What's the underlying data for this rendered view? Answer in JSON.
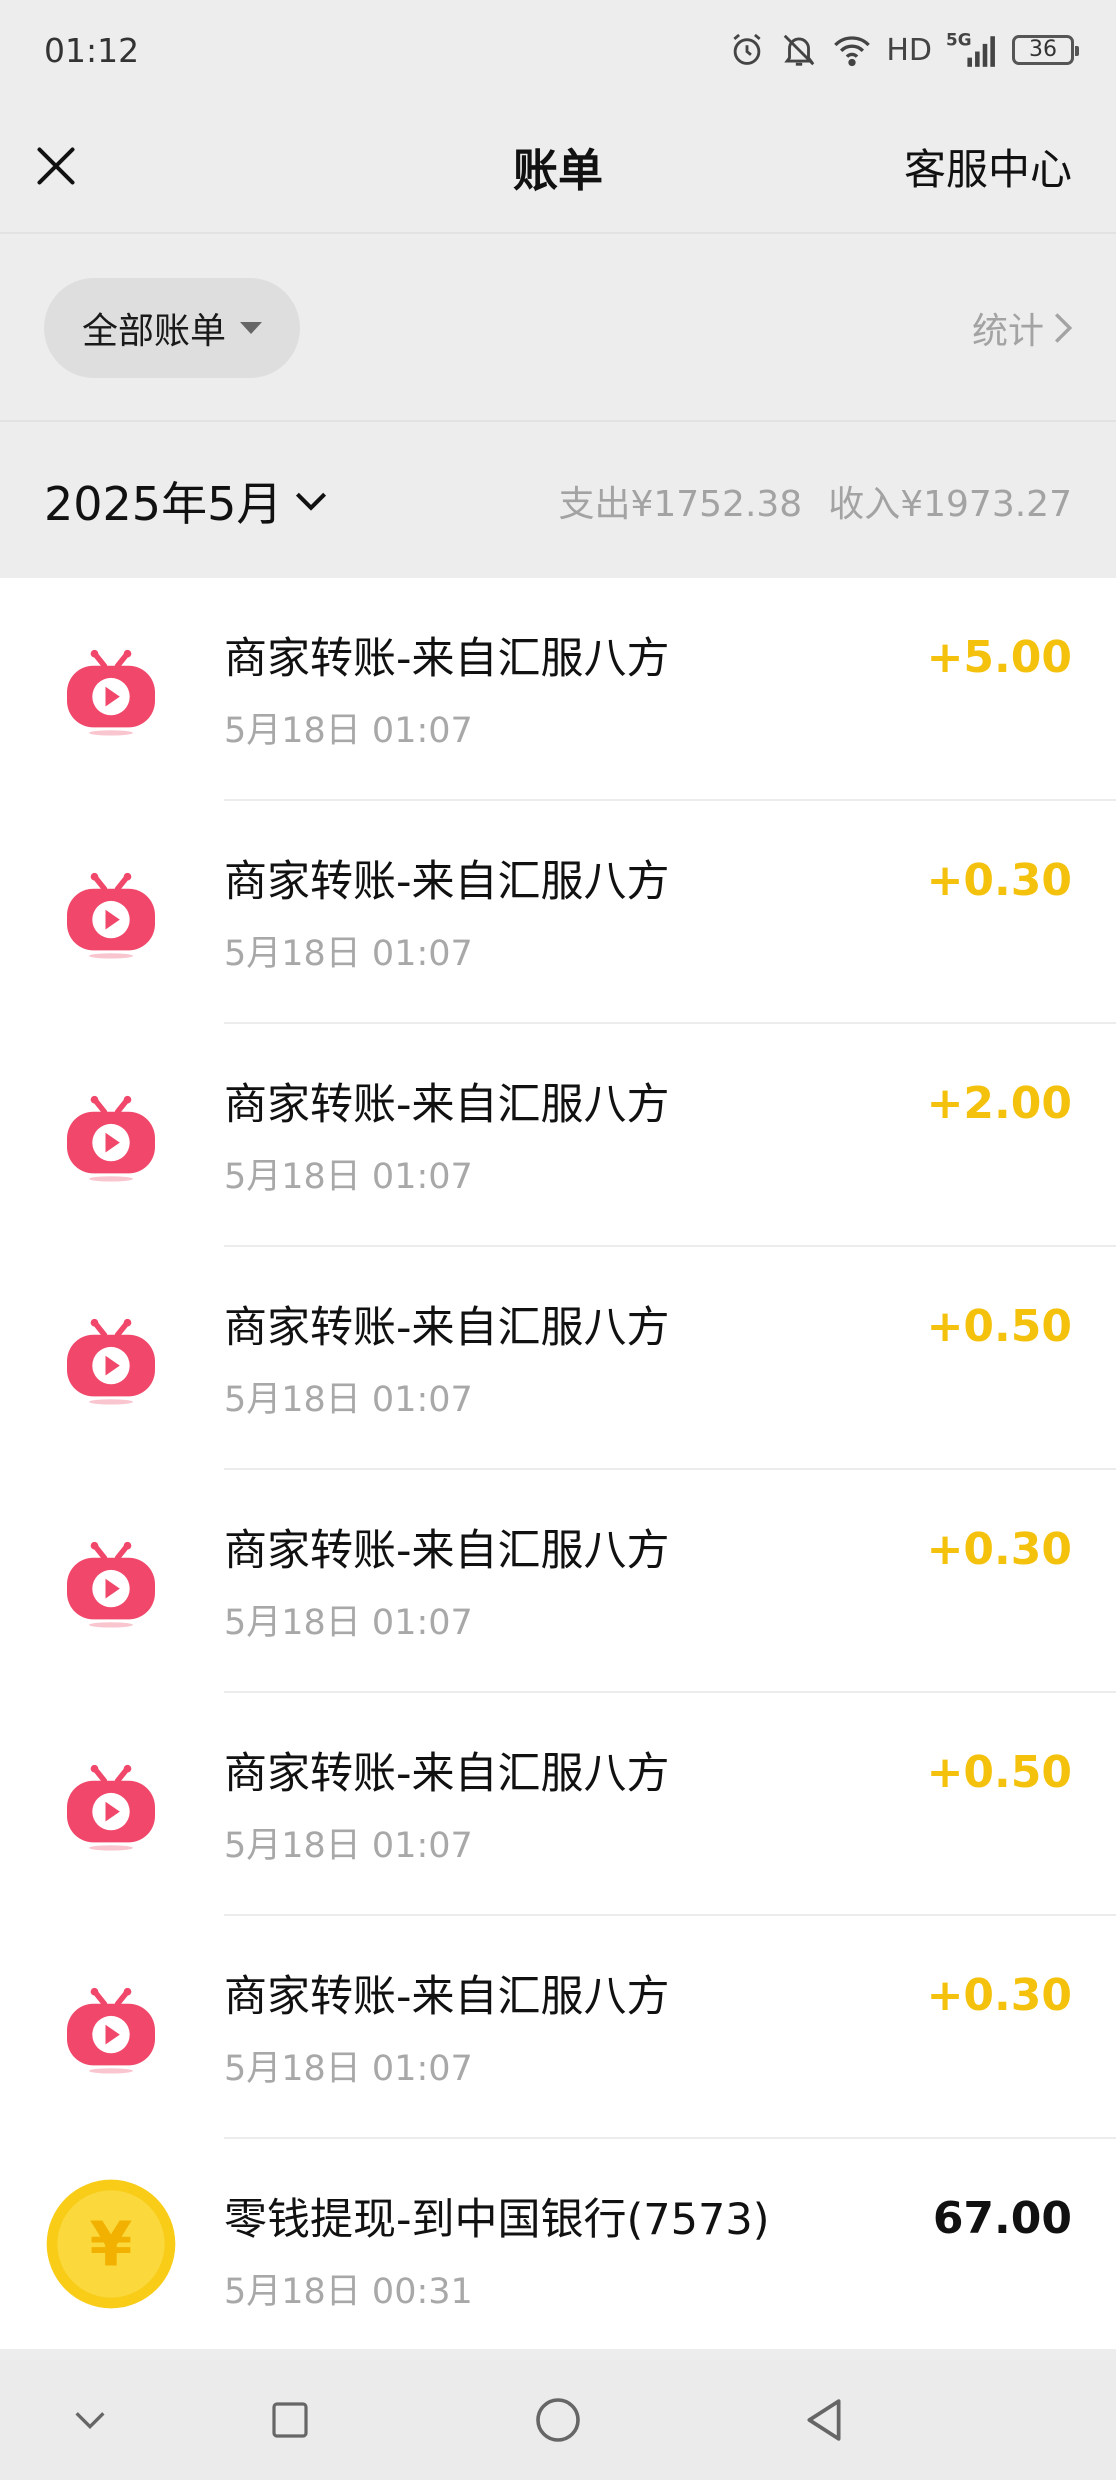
{
  "status_bar": {
    "time": "01:12",
    "network": "HD",
    "signal_label": "5G",
    "battery": "36"
  },
  "nav": {
    "title": "账单",
    "service": "客服中心"
  },
  "filter": {
    "label": "全部账单",
    "stats": "统计"
  },
  "month": {
    "label": "2025年5月",
    "expense": "支出¥1752.38",
    "income": "收入¥1973.27"
  },
  "colors": {
    "income_amount": "#f4c20d",
    "neutral_amount": "#111111",
    "merchant_icon": "#f0476a",
    "coin_icon": "#f8cc17"
  },
  "transactions": [
    {
      "title": "商家转账-来自汇服八方",
      "time": "5月18日 01:07",
      "amount": "+5.00",
      "icon": "tv-play-icon"
    },
    {
      "title": "商家转账-来自汇服八方",
      "time": "5月18日 01:07",
      "amount": "+0.30",
      "icon": "tv-play-icon"
    },
    {
      "title": "商家转账-来自汇服八方",
      "time": "5月18日 01:07",
      "amount": "+2.00",
      "icon": "tv-play-icon"
    },
    {
      "title": "商家转账-来自汇服八方",
      "time": "5月18日 01:07",
      "amount": "+0.50",
      "icon": "tv-play-icon"
    },
    {
      "title": "商家转账-来自汇服八方",
      "time": "5月18日 01:07",
      "amount": "+0.30",
      "icon": "tv-play-icon"
    },
    {
      "title": "商家转账-来自汇服八方",
      "time": "5月18日 01:07",
      "amount": "+0.50",
      "icon": "tv-play-icon"
    },
    {
      "title": "商家转账-来自汇服八方",
      "time": "5月18日 01:07",
      "amount": "+0.30",
      "icon": "tv-play-icon"
    },
    {
      "title": "零钱提现-到中国银行(7573)",
      "time": "5月18日 00:31",
      "amount": "67.00",
      "icon": "yuan-coin-icon",
      "coin_symbol": "¥"
    }
  ]
}
